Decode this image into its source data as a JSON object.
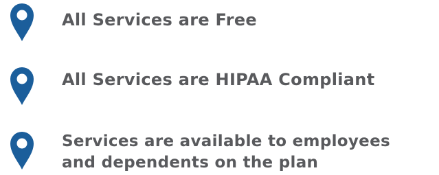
{
  "accent_color": "#1b5e9b",
  "text_color": "#595a5d",
  "items": [
    {
      "icon": "map-pin-icon",
      "text": "All Services are Free"
    },
    {
      "icon": "map-pin-icon",
      "text": "All Services are HIPAA Compliant"
    },
    {
      "icon": "map-pin-icon",
      "lines": [
        "Services are available to employees",
        "and dependents on the plan"
      ]
    }
  ]
}
